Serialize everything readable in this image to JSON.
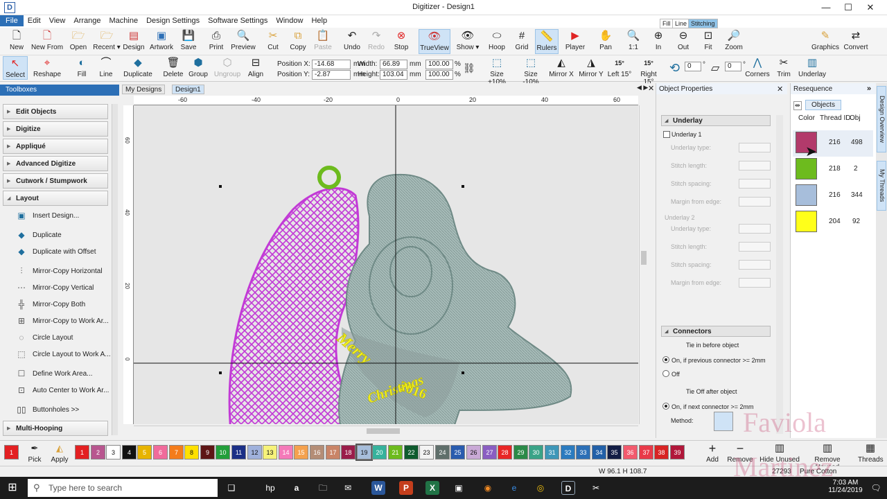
{
  "app": {
    "title": "Digitizer - Design1",
    "icon_letter": "D",
    "window_controls": [
      "—",
      "☐",
      "✕"
    ]
  },
  "menu": [
    "File",
    "Edit",
    "View",
    "Arrange",
    "Machine",
    "Design Settings",
    "Software Settings",
    "Window",
    "Help"
  ],
  "toolbar1": [
    {
      "label": "New",
      "icon": "new-doc-icon"
    },
    {
      "label": "New From",
      "icon": "new-from-icon"
    },
    {
      "label": "Open",
      "icon": "open-folder-icon"
    },
    {
      "label": "Recent ▾",
      "icon": "recent-icon"
    },
    {
      "label": "Design",
      "icon": "design-icon"
    },
    {
      "label": "Artwork",
      "icon": "artwork-icon"
    },
    {
      "label": "Save",
      "icon": "save-icon"
    },
    {
      "label": "Print",
      "icon": "print-icon"
    },
    {
      "label": "Preview",
      "icon": "preview-icon"
    },
    {
      "label": "Cut",
      "icon": "cut-icon"
    },
    {
      "label": "Copy",
      "icon": "copy-icon"
    },
    {
      "label": "Paste",
      "icon": "paste-icon"
    },
    {
      "label": "Undo",
      "icon": "undo-icon"
    },
    {
      "label": "Redo",
      "icon": "redo-icon"
    },
    {
      "label": "Stop",
      "icon": "stop-icon"
    },
    {
      "label": "TrueView",
      "icon": "trueview-icon"
    },
    {
      "label": "Show ▾",
      "icon": "show-icon"
    },
    {
      "label": "Hoop",
      "icon": "hoop-icon"
    },
    {
      "label": "Grid",
      "icon": "grid-icon"
    },
    {
      "label": "Rulers",
      "icon": "rulers-icon"
    },
    {
      "label": "Player",
      "icon": "player-icon"
    },
    {
      "label": "Pan",
      "icon": "pan-icon"
    },
    {
      "label": "1:1",
      "icon": "zoom-1to1-icon"
    },
    {
      "label": "In",
      "icon": "zoom-in-icon"
    },
    {
      "label": "Out",
      "icon": "zoom-out-icon"
    },
    {
      "label": "Fit",
      "icon": "zoom-fit-icon"
    },
    {
      "label": "Zoom",
      "icon": "zoom-icon"
    },
    {
      "label": "Graphics",
      "icon": "graphics-icon"
    },
    {
      "label": "Convert",
      "icon": "convert-icon"
    }
  ],
  "zoom_value": "100",
  "zoom_unit": "%",
  "toolbar2": {
    "tools": [
      "Select",
      "Reshape",
      "Fill",
      "Line",
      "Duplicate",
      "Delete",
      "Group",
      "Ungroup",
      "Align"
    ],
    "position_x_label": "Position X:",
    "position_x": "-14.68",
    "position_y_label": "Position Y:",
    "position_y": "-2.87",
    "width_label": "Width:",
    "width": "66.89",
    "height_label": "Height:",
    "height": "103.04",
    "unit": "mm",
    "scale_w": "100.00",
    "scale_h": "100.00",
    "pct": "%",
    "right_tools": [
      "Size +10%",
      "Size -10%",
      "Mirror X",
      "Mirror Y",
      "Left 15°",
      "Right 15°",
      "Corners",
      "Trim",
      "Underlay"
    ],
    "rotate_value": "0",
    "rotate_value2": "0",
    "rotate_unit": "°",
    "left15_top": "15°",
    "right15_top": "15°"
  },
  "toolboxes": {
    "title": "Toolboxes",
    "sections_top": [
      "Edit Objects",
      "Digitize",
      "Appliqué",
      "Advanced Digitize",
      "Cutwork / Stumpwork",
      "Layout"
    ],
    "layout_items": [
      "Insert Design...",
      "Duplicate",
      "Duplicate with Offset",
      "Mirror-Copy Horizontal",
      "Mirror-Copy Vertical",
      "Mirror-Copy Both",
      "Mirror-Copy to Work Ar...",
      "Circle Layout",
      "Circle Layout to Work A...",
      "Define Work Area...",
      "Auto Center to Work Ar...",
      "Buttonholes >>"
    ],
    "sections_bottom": [
      "Multi-Hooping"
    ]
  },
  "doc_tabs": [
    "My Designs",
    "Design1"
  ],
  "ruler": {
    "h_ticks": [
      "-60",
      "-40",
      "-20",
      "0",
      "20",
      "40",
      "60"
    ],
    "v_ticks": [
      "60",
      "40",
      "20",
      "0"
    ]
  },
  "design_text": {
    "merry": "Merry",
    "year": "2016",
    "christmas": "Christmas"
  },
  "object_properties": {
    "title": "Object Properties",
    "tabs": [
      "Fill",
      "Line",
      "Stitching"
    ],
    "underlay_section": "Underlay",
    "underlay1": "Underlay 1",
    "underlay2": "Underlay 2",
    "fields": [
      "Underlay type:",
      "Stitch length:",
      "Stitch spacing:",
      "Margin from edge:"
    ],
    "connectors_section": "Connectors",
    "tie_in": "Tie in before object",
    "tie_in_on": "On, if previous connector >= 2mm",
    "tie_in_off": "Off",
    "tie_off": "Tie Off after object",
    "tie_off_on": "On, if next connector >= 2mm",
    "method": "Method:"
  },
  "resequence": {
    "title": "Resequence",
    "objects_btn": "Objects",
    "headers": [
      "Color",
      "Thread ID",
      "Obj"
    ],
    "rows": [
      {
        "color": "#b23a6b",
        "thread": "216",
        "obj": "498"
      },
      {
        "color": "#6dbb1e",
        "thread": "218",
        "obj": "2"
      },
      {
        "color": "#a7bedb",
        "thread": "216",
        "obj": "344"
      },
      {
        "color": "#ffff1a",
        "thread": "204",
        "obj": "92"
      }
    ]
  },
  "side_tabs": [
    "Design Overview",
    "My Threads"
  ],
  "palette": {
    "current": "1",
    "pick": "Pick",
    "apply": "Apply",
    "colors": [
      {
        "n": "1",
        "c": "#e32022"
      },
      {
        "n": "2",
        "c": "#b8568f"
      },
      {
        "n": "3",
        "c": "#ffffff"
      },
      {
        "n": "4",
        "c": "#111111"
      },
      {
        "n": "5",
        "c": "#e7b400"
      },
      {
        "n": "6",
        "c": "#f06b9b"
      },
      {
        "n": "7",
        "c": "#f47c1b"
      },
      {
        "n": "8",
        "c": "#ffe000"
      },
      {
        "n": "9",
        "c": "#5e1616"
      },
      {
        "n": "10",
        "c": "#229e3a"
      },
      {
        "n": "11",
        "c": "#1b2f86"
      },
      {
        "n": "12",
        "c": "#9fb1dc"
      },
      {
        "n": "13",
        "c": "#f6f27a"
      },
      {
        "n": "14",
        "c": "#f47ab9"
      },
      {
        "n": "15",
        "c": "#f4a14e"
      },
      {
        "n": "16",
        "c": "#b48d76"
      },
      {
        "n": "17",
        "c": "#c98467"
      },
      {
        "n": "18",
        "c": "#9a1d4a"
      },
      {
        "n": "19",
        "c": "#a7bedb"
      },
      {
        "n": "20",
        "c": "#36b29c"
      },
      {
        "n": "21",
        "c": "#6dbb1e"
      },
      {
        "n": "22",
        "c": "#0f5b2e"
      },
      {
        "n": "23",
        "c": "#f3f3f3"
      },
      {
        "n": "24",
        "c": "#5f6f6b"
      },
      {
        "n": "25",
        "c": "#2a5cae"
      },
      {
        "n": "26",
        "c": "#c9a9d6"
      },
      {
        "n": "27",
        "c": "#8a5ec2"
      },
      {
        "n": "28",
        "c": "#e82626"
      },
      {
        "n": "29",
        "c": "#2b8a48"
      },
      {
        "n": "30",
        "c": "#3aa387"
      },
      {
        "n": "31",
        "c": "#3e97b8"
      },
      {
        "n": "32",
        "c": "#2b7bbf"
      },
      {
        "n": "33",
        "c": "#2c6fb6"
      },
      {
        "n": "34",
        "c": "#2260a8"
      },
      {
        "n": "35",
        "c": "#121d45"
      },
      {
        "n": "36",
        "c": "#f25a6d"
      },
      {
        "n": "37",
        "c": "#e83a49"
      },
      {
        "n": "38",
        "c": "#d82424"
      },
      {
        "n": "39",
        "c": "#b1173a"
      }
    ],
    "right_actions": [
      "Add",
      "Remove",
      "Hide Unused",
      "Remove Unused",
      "Threads"
    ]
  },
  "status": {
    "dims": "W 96.1 H 108.7",
    "count": "27293",
    "thread": "Pure Cotton"
  },
  "taskbar": {
    "search_placeholder": "Type here to search",
    "time": "7:03 AM",
    "date": "11/24/2019"
  },
  "watermark": [
    "Faviola",
    "Martinez"
  ],
  "colors": {
    "accent": "#2c6fb6",
    "magenta": "#c23ad6",
    "grey_stitch": "#9fb3b0",
    "yellow": "#f2ef1e",
    "green": "#6dbb1e"
  }
}
